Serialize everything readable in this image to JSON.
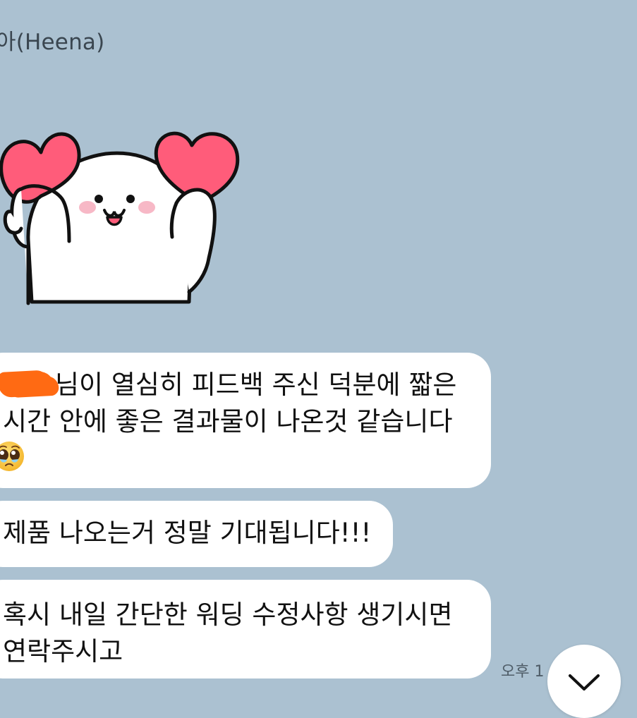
{
  "chat": {
    "sender_name": "아(Heena)",
    "sticker_icon": "cat-with-hearts-sticker",
    "messages": [
      {
        "redacted_prefix": true,
        "line1": "님이 열심히 피드백 주신 덕분에 짧은",
        "line2": "시간 안에 좋은 결과물이 나온것 같습니다",
        "emoji": "pleading-face-emoji"
      },
      {
        "line1": "제품 나오는거 정말 기대됩니다!!!"
      },
      {
        "line1": "혹시 내일 간단한 워딩 수정사항 생기시면",
        "line2": "연락주시고"
      }
    ],
    "timestamp": "오후 1",
    "scroll_down_icon": "chevron-down-icon"
  },
  "colors": {
    "background": "#abc1d1",
    "bubble": "#ffffff",
    "redaction": "#ff6a13",
    "heart": "#ff5c7a"
  }
}
